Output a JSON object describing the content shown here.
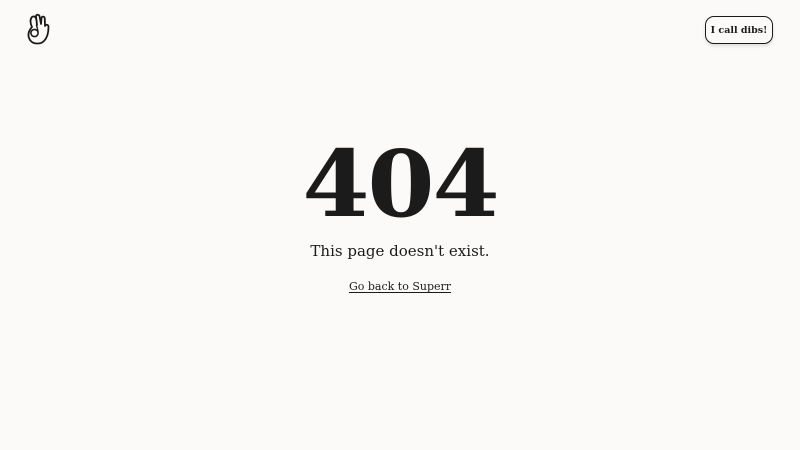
{
  "header": {
    "logo_icon": "hand-peace-icon",
    "dibs_label": "I call dibs!"
  },
  "main": {
    "code": "404",
    "message": "This page doesn't exist.",
    "back_link_label": "Go back to Superr"
  },
  "colors": {
    "background": "#fcfaf8",
    "text": "#1b1b1b"
  }
}
